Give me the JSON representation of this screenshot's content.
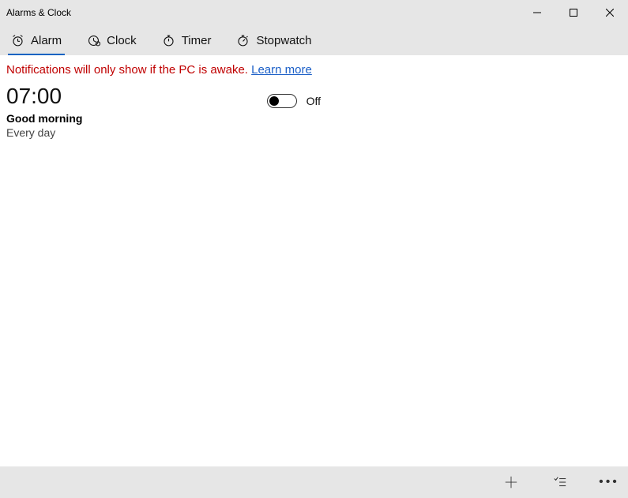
{
  "window": {
    "title": "Alarms & Clock"
  },
  "tabs": {
    "alarm": {
      "label": "Alarm",
      "active": true
    },
    "clock": {
      "label": "Clock",
      "active": false
    },
    "timer": {
      "label": "Timer",
      "active": false
    },
    "stopwatch": {
      "label": "Stopwatch",
      "active": false
    }
  },
  "notice": {
    "text": "Notifications will only show if the PC is awake. ",
    "link_label": "Learn more"
  },
  "alarms": [
    {
      "time": "07:00",
      "name": "Good morning",
      "repeat": "Every day",
      "enabled": false,
      "toggle_label": "Off"
    }
  ],
  "bottombar": {
    "add_label": "Add alarm",
    "select_label": "Select alarms",
    "more_label": "More"
  }
}
